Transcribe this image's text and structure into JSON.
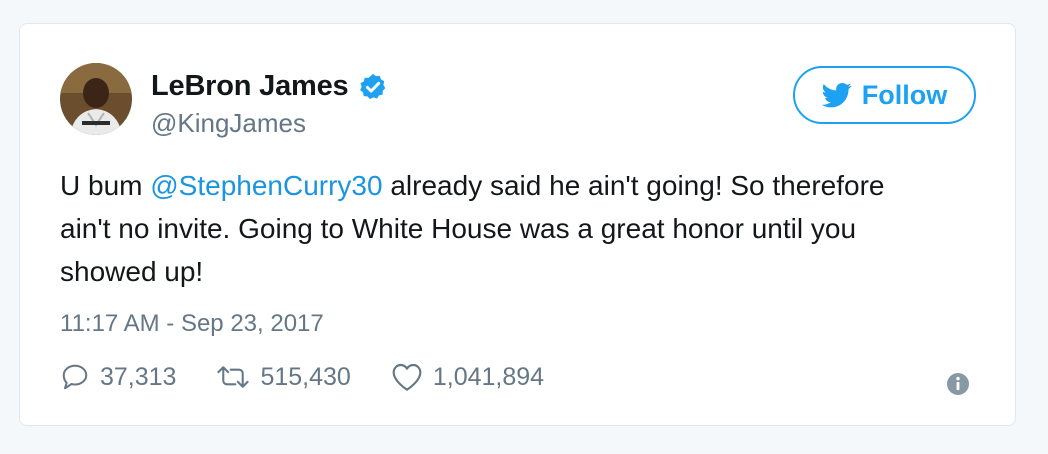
{
  "tweet": {
    "display_name": "LeBron James",
    "handle": "@KingJames",
    "verified": true,
    "text_parts": {
      "before_mention": "U bum ",
      "mention": "@StephenCurry30",
      "after_mention": " already said he ain't going! So therefore ain't no invite. Going to White House was a great honor until you showed up!"
    },
    "timestamp": "11:17 AM - Sep 23, 2017"
  },
  "follow_button": {
    "label": "Follow",
    "icon": "twitter-bird-icon"
  },
  "actions": {
    "replies": "37,313",
    "retweets": "515,430",
    "likes": "1,041,894"
  },
  "icons": {
    "reply": "reply-bubble-icon",
    "retweet": "retweet-icon",
    "like": "heart-icon",
    "info": "info-icon",
    "verified": "verified-badge-icon"
  },
  "colors": {
    "twitter_blue": "#1da1f2",
    "mention_blue": "#1b95e0",
    "text_primary": "#14171a",
    "text_secondary": "#657786",
    "border": "#e1e8ed"
  }
}
